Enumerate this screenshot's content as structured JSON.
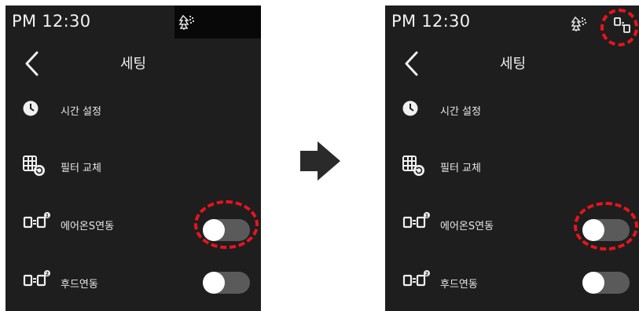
{
  "left_screen": {
    "status": {
      "time": "PM 12:30",
      "icons": [
        "filter-alert-icon"
      ]
    },
    "header": {
      "title": "세팅",
      "back_icon": "chevron-left-icon"
    },
    "rows": [
      {
        "icon": "clock-icon",
        "label": "시간 설정"
      },
      {
        "icon": "filter-replace-icon",
        "label": "필터 교체"
      },
      {
        "icon": "link-device-1-icon",
        "label": "에어온S연동",
        "toggle": false,
        "highlighted": true
      },
      {
        "icon": "link-device-2-icon",
        "label": "후드연동",
        "toggle": false
      }
    ]
  },
  "right_screen": {
    "status": {
      "time": "PM 12:30",
      "icons": [
        "filter-alert-icon",
        "linked-status-icon"
      ],
      "highlighted_icon": "linked-status-icon"
    },
    "header": {
      "title": "세팅",
      "back_icon": "chevron-left-icon"
    },
    "rows": [
      {
        "icon": "clock-icon",
        "label": "시간 설정"
      },
      {
        "icon": "filter-replace-icon",
        "label": "필터 교체"
      },
      {
        "icon": "link-device-1-icon",
        "label": "에어온S연동",
        "toggle": false,
        "highlighted": true
      },
      {
        "icon": "link-device-2-icon",
        "label": "후드연동",
        "toggle": false
      }
    ]
  },
  "transition": {
    "icon": "arrow-right-icon"
  },
  "colors": {
    "screen_bg": "#1e1e1e",
    "highlight": "#e8141d",
    "toggle_track": "#5a5a5a",
    "text": "#f0f0f0"
  }
}
